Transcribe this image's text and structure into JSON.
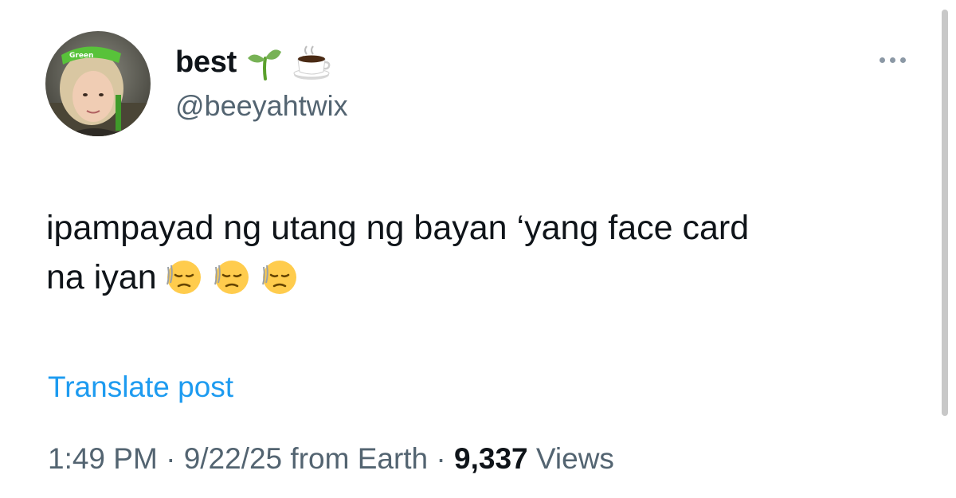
{
  "user": {
    "display_name": "best",
    "handle": "@beeyahtwix",
    "name_emojis": [
      "seedling-emoji",
      "hot-beverage-emoji"
    ],
    "avatar_badge_text": "Green"
  },
  "post": {
    "text_line1": "ipampayad ng utang ng bayan ‘yang face card",
    "text_line2": "na iyan",
    "trailing_emojis": [
      "pensive-face-emoji",
      "pensive-face-emoji",
      "pensive-face-emoji"
    ]
  },
  "actions": {
    "translate_label": "Translate post"
  },
  "meta": {
    "time": "1:49 PM",
    "separator": " · ",
    "date": "9/22/25",
    "location": "from Earth",
    "views_count": "9,337",
    "views_label": "Views"
  },
  "colors": {
    "link": "#1d9bf0",
    "secondary_text": "#536471",
    "primary_text": "#0f1419",
    "background": "#ffffff"
  }
}
